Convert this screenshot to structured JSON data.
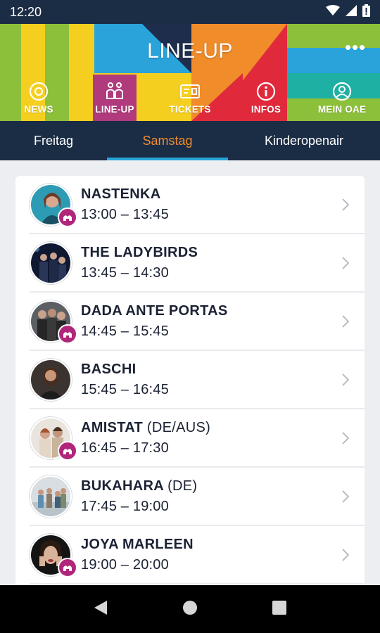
{
  "status_bar": {
    "time": "12:20"
  },
  "header": {
    "title": "LINE-UP",
    "nav": [
      {
        "label": "NEWS",
        "icon": "news-icon"
      },
      {
        "label": "LINE-UP",
        "icon": "lineup-icon",
        "active": true
      },
      {
        "label": "TICKETS",
        "icon": "ticket-icon"
      },
      {
        "label": "INFOS",
        "icon": "info-icon"
      },
      {
        "label": "MEIN OAE",
        "icon": "profile-icon"
      }
    ]
  },
  "tabs": [
    {
      "label": "Freitag"
    },
    {
      "label": "Samstag",
      "active": true
    },
    {
      "label": "Kinderopenair"
    }
  ],
  "lineup": [
    {
      "name": "NASTENKA",
      "country": "",
      "time": "13:00 – 13:45",
      "badge": true
    },
    {
      "name": "THE LADYBIRDS",
      "country": "",
      "time": "13:45 – 14:30",
      "badge": false
    },
    {
      "name": "DADA ANTE PORTAS",
      "country": "",
      "time": "14:45 – 15:45",
      "badge": true
    },
    {
      "name": "BASCHI",
      "country": "",
      "time": "15:45 – 16:45",
      "badge": false
    },
    {
      "name": "AMISTAT",
      "country": "(DE/AUS)",
      "time": "16:45 – 17:30",
      "badge": true
    },
    {
      "name": "BUKAHARA",
      "country": "(DE)",
      "time": "17:45 – 19:00",
      "badge": false
    },
    {
      "name": "JOYA MARLEEN",
      "country": "",
      "time": "19:00 – 20:00",
      "badge": true
    }
  ],
  "colors": {
    "dark_navy": "#1b2c45",
    "active_tab": "#f08c2a",
    "tab_indicator": "#27a5d8",
    "badge": "#b0277a",
    "nav_active": "#b03a7c"
  }
}
